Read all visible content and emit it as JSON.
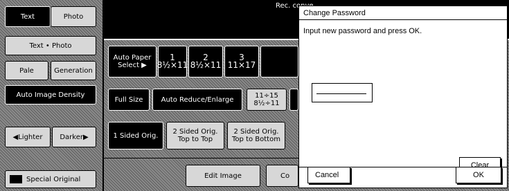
{
  "left_panel": {
    "text_label": "Text",
    "photo_label": "Photo",
    "text_photo_label": "Text • Photo",
    "pale_label": "Pale",
    "generation_label": "Generation",
    "auto_density_label": "Auto Image Density",
    "lighter_label": "◀Lighter",
    "darker_label": "Darker▶",
    "special_original_label": "Special Original"
  },
  "top_bar": {
    "status_text": "Rec. conve"
  },
  "paper": {
    "auto_paper_label": "Auto Paper Select ▶",
    "trays": [
      {
        "num": "1",
        "size": "8½×11"
      },
      {
        "num": "2",
        "size": "8½×11"
      },
      {
        "num": "3",
        "size": "11×17"
      }
    ]
  },
  "ratio": {
    "full_size_label": "Full Size",
    "auto_reduce_label": "Auto Reduce/Enlarge",
    "preset_top": "11÷15",
    "preset_bottom": "8½÷11"
  },
  "sided": {
    "one_sided_label": "1 Sided Orig.",
    "two_top_label": "2 Sided Orig. Top to Top",
    "two_bottom_label": "2 Sided Orig. Top to Bottom"
  },
  "bottom": {
    "edit_image_label": "Edit Image",
    "partial_label": "Co"
  },
  "dialog": {
    "title": "Change Password",
    "message": "Input new password and press OK.",
    "clear_label": "Clear",
    "cancel_label": "Cancel",
    "ok_label": "OK"
  }
}
